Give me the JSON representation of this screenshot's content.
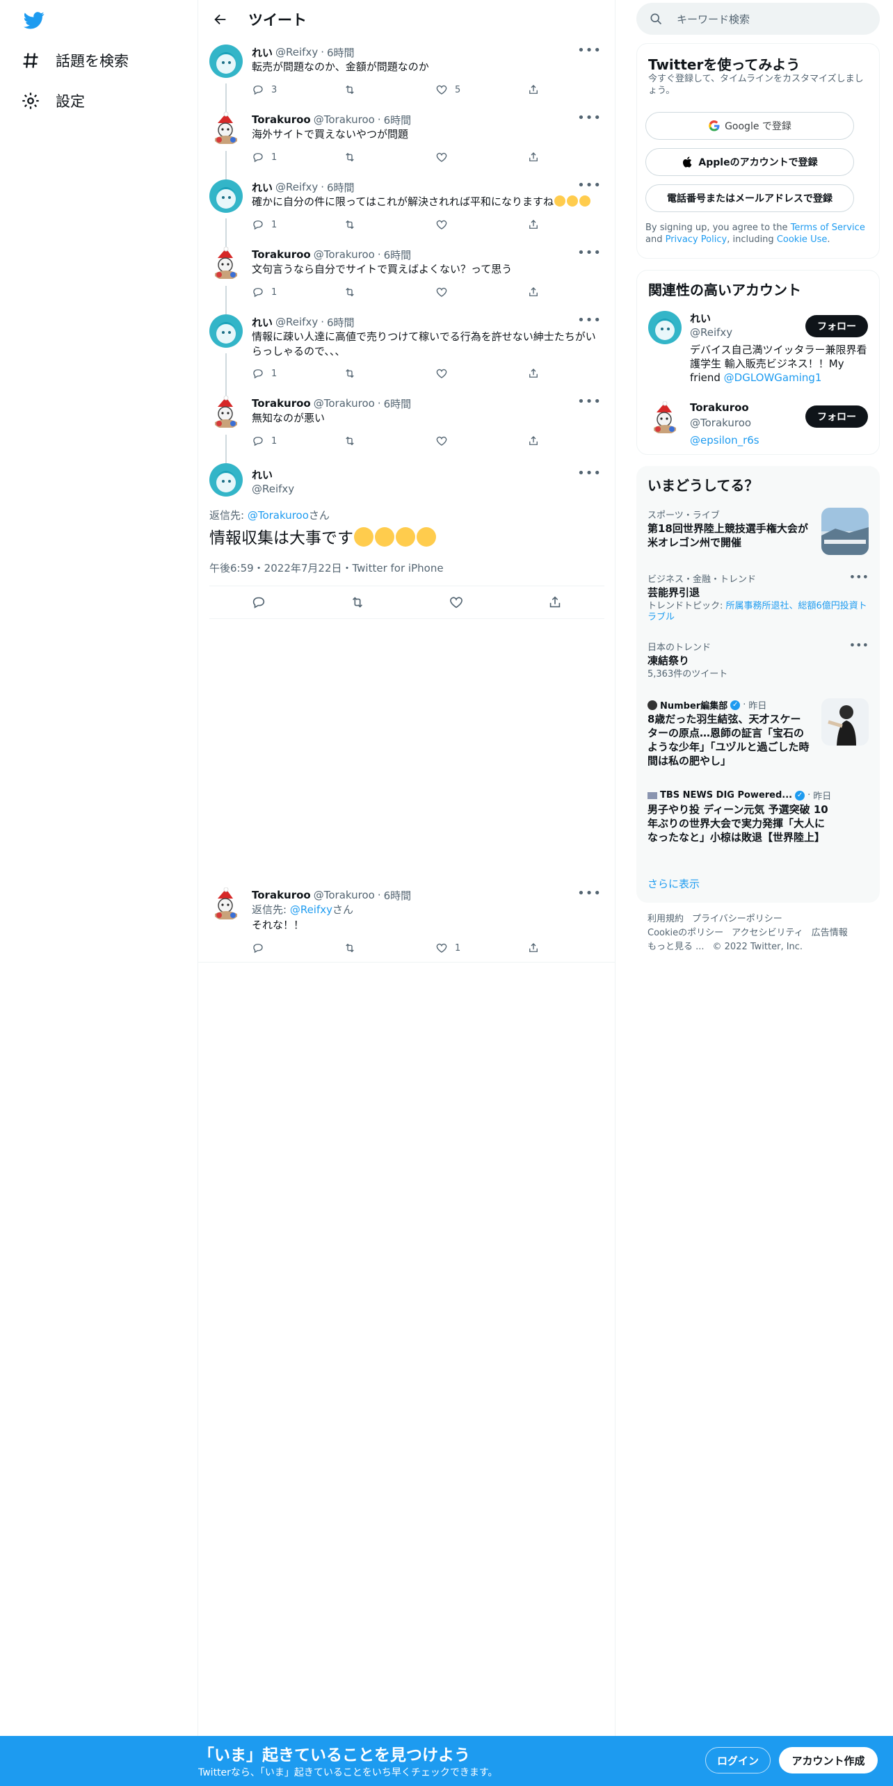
{
  "colors": {
    "accent": "#1d9bf0",
    "text": "#0f1419",
    "secondary": "#536471"
  },
  "nav": {
    "logo_icon": "twitter-bird-icon",
    "items": [
      {
        "icon": "hashtag-icon",
        "label": "話題を検索"
      },
      {
        "icon": "gear-icon",
        "label": "設定"
      }
    ]
  },
  "header": {
    "back_icon": "arrow-left-icon",
    "title": "ツイート"
  },
  "thread": [
    {
      "name": "れい",
      "handle": "@Reifxy",
      "time": "6時間",
      "text": "転売が問題なのか、金額が問題なのか",
      "replies": "3",
      "retweets": "",
      "likes": "5"
    },
    {
      "name": "Torakuroo",
      "handle": "@Torakuroo",
      "time": "6時間",
      "text": "海外サイトで買えないやつが問題",
      "replies": "1",
      "retweets": "",
      "likes": ""
    },
    {
      "name": "れい",
      "handle": "@Reifxy",
      "time": "6時間",
      "text": "確かに自分の件に限ってはこれが解決されれば平和になりますね",
      "replies": "1",
      "retweets": "",
      "likes": ""
    },
    {
      "name": "Torakuroo",
      "handle": "@Torakuroo",
      "time": "6時間",
      "text": "文句言うなら自分でサイトで買えばよくない？って思う",
      "replies": "1",
      "retweets": "",
      "likes": ""
    },
    {
      "name": "れい",
      "handle": "@Reifxy",
      "time": "6時間",
      "text": "情報に疎い人達に高値で売りつけて稼いでる行為を許せない紳士たちがいらっしゃるので、、、",
      "replies": "1",
      "retweets": "",
      "likes": ""
    },
    {
      "name": "Torakuroo",
      "handle": "@Torakuroo",
      "time": "6時間",
      "text": "無知なのが悪い",
      "replies": "1",
      "retweets": "",
      "likes": ""
    }
  ],
  "focused": {
    "name": "れい",
    "handle": "@Reifxy",
    "reply_prefix": "返信先: ",
    "reply_to": "@Torakuroo",
    "reply_suffix": "さん",
    "text": "情報収集は大事です",
    "meta": "午後6:59・2022年7月22日・Twitter for iPhone"
  },
  "reply": {
    "name": "Torakuroo",
    "handle": "@Torakuroo",
    "time": "6時間",
    "reply_prefix": "返信先: ",
    "reply_to": "@Reifxy",
    "reply_suffix": "さん",
    "text": "それな！！",
    "replies": "",
    "retweets": "",
    "likes": "1"
  },
  "search": {
    "placeholder": "キーワード検索"
  },
  "signup": {
    "title": "Twitterを使ってみよう",
    "desc": "今すぐ登録して、タイムラインをカスタマイズしましょう。",
    "google": "Google で登録",
    "apple": "Appleのアカウントで登録",
    "phone": "電話番号またはメールアドレスで登録",
    "terms_1": "By signing up, you agree to the ",
    "terms_link1": "Terms of Service",
    "terms_2": " and ",
    "terms_link2": "Privacy Policy",
    "terms_3": ", including ",
    "terms_link3": "Cookie Use",
    "terms_4": "."
  },
  "related": {
    "title": "関連性の高いアカウント",
    "accounts": [
      {
        "name": "れい",
        "handle": "@Reifxy",
        "bio": "デバイス自己満ツイッタラー兼限界看護学生 輸入販売ビジネス！！My friend ",
        "bio_link": "@DGLOWGaming1",
        "follow": "フォロー"
      },
      {
        "name": "Torakuroo",
        "handle": "@Torakuroo",
        "bio": "",
        "bio_link": "@epsilon_r6s",
        "follow": "フォロー"
      }
    ]
  },
  "trends": {
    "title": "いまどうしてる？",
    "items": [
      {
        "category": "スポーツ・ライブ",
        "title": "第18回世界陸上競技選手権大会が米オレゴン州で開催"
      },
      {
        "category": "ビジネス・金融・トレンド",
        "title": "芸能界引退",
        "sub_prefix": "トレンドトピック: ",
        "sub_link": "所属事務所退社、総額6億円投資トラブル"
      },
      {
        "category": "日本のトレンド",
        "title": "凍結祭り",
        "sub": "5,363件のツイート"
      },
      {
        "source": "Number編集部",
        "time": "昨日",
        "title": "8歳だった羽生結弦、天才スケーターの原点…恩師の証言「宝石のような少年」「ユヅルと過ごした時間は私の肥やし」"
      },
      {
        "source": "TBS NEWS DIG Powered...",
        "time": "昨日",
        "title": "男子やり投 ディーン元気 予選突破 10年ぶりの世界大会で実力発揮「大人になったなと」小椋は敗退【世界陸上】"
      }
    ],
    "show_more": "さらに表示"
  },
  "footer": {
    "row1": [
      "利用規約",
      "プライバシーポリシー"
    ],
    "row2": [
      "Cookieのポリシー",
      "アクセシビリティ",
      "広告情報"
    ],
    "row3": [
      "もっと見る ...",
      "© 2022 Twitter, Inc."
    ]
  },
  "banner": {
    "title": "「いま」起きていることを見つけよう",
    "sub": "Twitterなら、「いま」起きていることをいち早くチェックできます。",
    "login": "ログイン",
    "signup": "アカウント作成"
  }
}
